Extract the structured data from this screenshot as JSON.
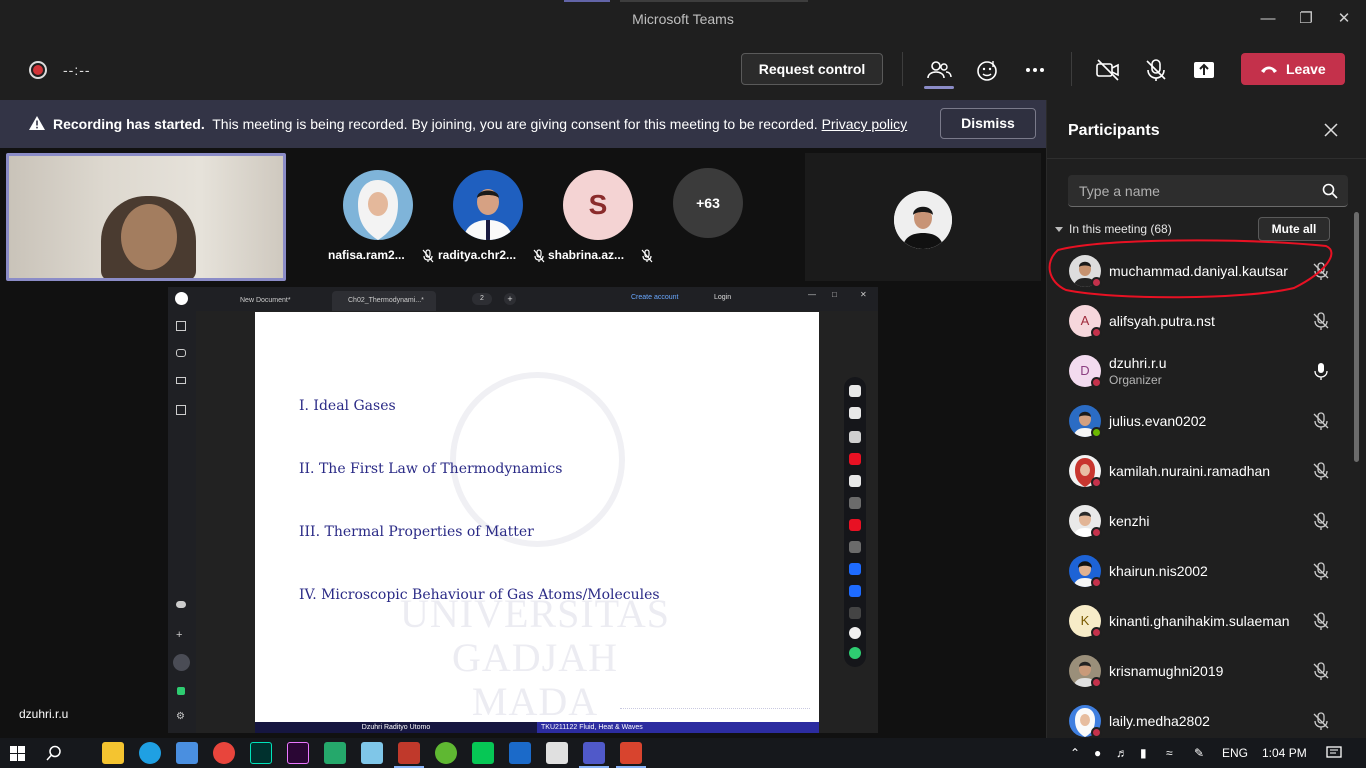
{
  "window": {
    "title": "Microsoft Teams"
  },
  "toolbar": {
    "timer": "--:--",
    "request_control": "Request control",
    "leave": "Leave"
  },
  "banner": {
    "bold": "Recording has started.",
    "text": "This meeting is being recorded. By joining, you are giving consent for this meeting to be recorded.",
    "link": "Privacy policy",
    "dismiss": "Dismiss"
  },
  "stage": {
    "tiles": [
      {
        "name": "nafisa.ram2...",
        "kind": "photo-hijab"
      },
      {
        "name": "raditya.chr2...",
        "kind": "photo-formal"
      },
      {
        "name": "shabrina.az...",
        "kind": "initial",
        "initial": "S"
      }
    ],
    "overflow": "+63",
    "presenter": "dzuhri.r.u"
  },
  "shared": {
    "tabs": [
      "New Document*",
      "Ch02_Thermodynami...*"
    ],
    "page": "2",
    "create_account": "Create account",
    "login": "Login",
    "slide_items": [
      "I. Ideal Gases",
      "II. The First Law of Thermodynamics",
      "III. Thermal Properties of Matter",
      "IV. Microscopic Behaviour of Gas Atoms/Molecules"
    ],
    "watermark_line1": "UNIVERSITAS",
    "watermark_line2": "GADJAH MADA",
    "footer_left": "Dzuhri Radityo Utomo",
    "footer_right": "TKU211122  Fluid, Heat & Waves"
  },
  "panel": {
    "title": "Participants",
    "search_placeholder": "Type a name",
    "section": "In this meeting (68)",
    "mute_all": "Mute all",
    "participants": [
      {
        "name": "muchammad.daniyal.kautsar",
        "mic": "muted",
        "status": "busy"
      },
      {
        "name": "alifsyah.putra.nst",
        "initial": "A",
        "mic": "muted",
        "status": "busy"
      },
      {
        "name": "dzuhri.r.u",
        "role": "Organizer",
        "initial": "D",
        "mic": "on",
        "status": "busy"
      },
      {
        "name": "julius.evan0202",
        "mic": "muted",
        "status": "available"
      },
      {
        "name": "kamilah.nuraini.ramadhan",
        "mic": "muted",
        "status": "busy"
      },
      {
        "name": "kenzhi",
        "mic": "muted",
        "status": "busy"
      },
      {
        "name": "khairun.nis2002",
        "mic": "muted",
        "status": "busy"
      },
      {
        "name": "kinanti.ghanihakim.sulaeman",
        "initial": "K",
        "mic": "muted",
        "status": "busy"
      },
      {
        "name": "krisnamughni2019",
        "mic": "muted",
        "status": "busy"
      },
      {
        "name": "laily.medha2802",
        "mic": "muted",
        "status": "busy"
      }
    ]
  },
  "taskbar": {
    "language": "ENG",
    "time": "1:04 PM"
  },
  "colors": {
    "accent": "#6264a7",
    "leave": "#c4314b",
    "banner": "#333446",
    "panel": "#1f1f1f"
  }
}
